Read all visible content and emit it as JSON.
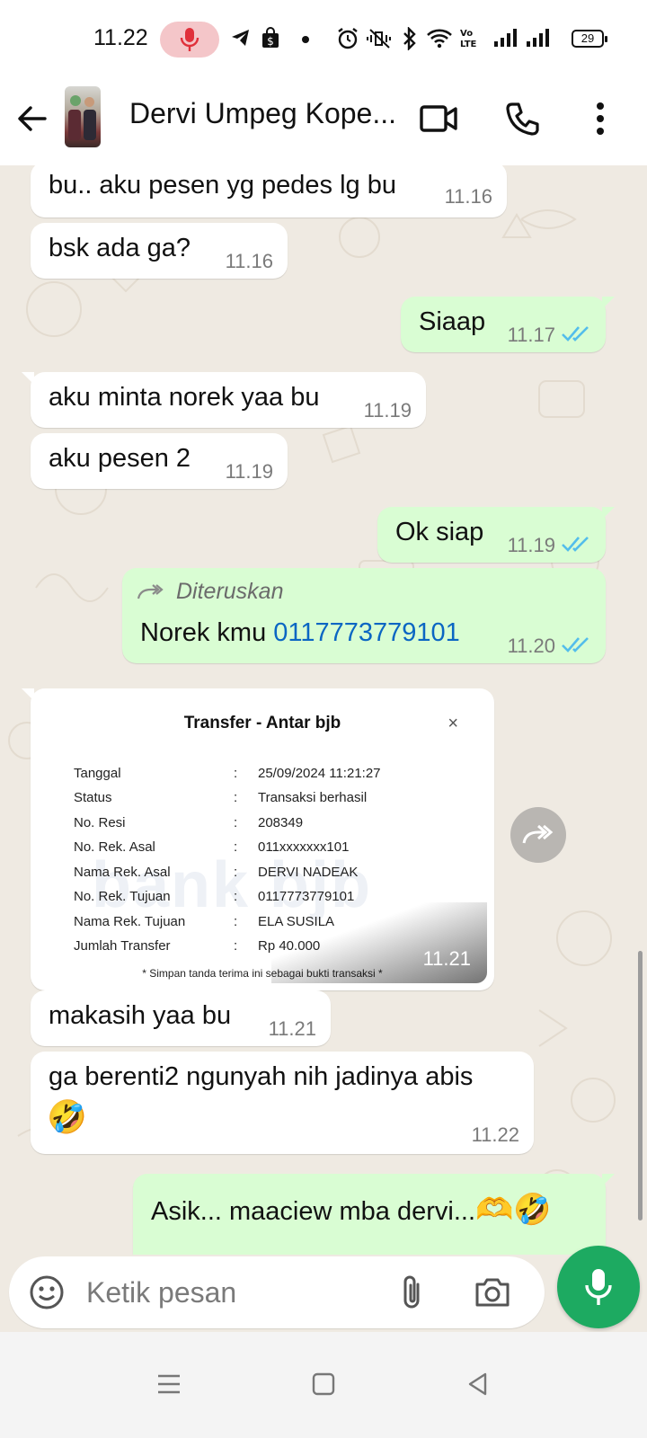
{
  "status_bar": {
    "time": "11.22",
    "battery": "29",
    "icons": [
      "mic-recording-icon",
      "telegram-icon",
      "shopping-bag-icon",
      "dot-icon",
      "alarm-icon",
      "vibrate-icon",
      "bluetooth-icon",
      "wifi-icon",
      "volte-icon",
      "signal-icon",
      "signal-icon",
      "battery-icon"
    ]
  },
  "header": {
    "contact_name": "Dervi Umpeg Kope...",
    "icons": [
      "back-arrow-icon",
      "video-call-icon",
      "phone-icon",
      "more-vert-icon"
    ]
  },
  "messages": [
    {
      "dir": "in",
      "text": "bu.. aku pesen yg pedes lg bu",
      "time": "11.16"
    },
    {
      "dir": "in",
      "text": "bsk ada ga?",
      "time": "11.16"
    },
    {
      "dir": "out",
      "text": "Siaap",
      "time": "11.17",
      "status": "read"
    },
    {
      "dir": "in",
      "text": "aku minta norek yaa bu",
      "time": "11.19"
    },
    {
      "dir": "in",
      "text": "aku pesen 2",
      "time": "11.19"
    },
    {
      "dir": "out",
      "text": "Ok siap",
      "time": "11.19",
      "status": "read"
    },
    {
      "dir": "out",
      "forwarded_label": "Diteruskan",
      "text": "Norek kmu ",
      "link": "0117773779101",
      "time": "11.20",
      "status": "read"
    },
    {
      "dir": "in",
      "type": "image",
      "time": "11.21"
    },
    {
      "dir": "in",
      "text": "makasih yaa bu",
      "time": "11.21"
    },
    {
      "dir": "in",
      "text": "ga berenti2 ngunyah nih jadinya abis",
      "emoji": "🤣",
      "time": "11.22"
    },
    {
      "dir": "out",
      "text": "Asik... maaciew mba dervi...",
      "emoji": "🫶🤣"
    }
  ],
  "receipt": {
    "title": "Transfer - Antar bjb",
    "close": "×",
    "watermark": "bank bjb",
    "rows": [
      {
        "label": "Tanggal",
        "sep": ":",
        "value": "25/09/2024 11:21:27"
      },
      {
        "label": "Status",
        "sep": ":",
        "value": "Transaksi berhasil"
      },
      {
        "label": "No. Resi",
        "sep": ":",
        "value": "208349"
      },
      {
        "label": "No. Rek. Asal",
        "sep": ":",
        "value": "011xxxxxxx101"
      },
      {
        "label": "Nama Rek. Asal",
        "sep": ":",
        "value": "DERVI NADEAK"
      },
      {
        "label": "No. Rek. Tujuan",
        "sep": ":",
        "value": "0117773779101"
      },
      {
        "label": "Nama Rek. Tujuan",
        "sep": ":",
        "value": "ELA SUSILA"
      },
      {
        "label": "Jumlah Transfer",
        "sep": ":",
        "value": "Rp 40.000"
      }
    ],
    "note": "* Simpan tanda terima ini sebagai bukti transaksi *"
  },
  "composer": {
    "placeholder": "Ketik pesan",
    "icons": [
      "emoji-icon",
      "attach-icon",
      "camera-icon",
      "mic-icon"
    ]
  },
  "nav": {
    "icons": [
      "menu-icon",
      "home-icon",
      "back-icon"
    ]
  },
  "colors": {
    "incoming": "#ffffff",
    "outgoing": "#d9fdd3",
    "chat_bg": "#efeae2",
    "accent": "#1daa61",
    "read_ticks": "#53bdeb",
    "link": "#0b66c3"
  }
}
